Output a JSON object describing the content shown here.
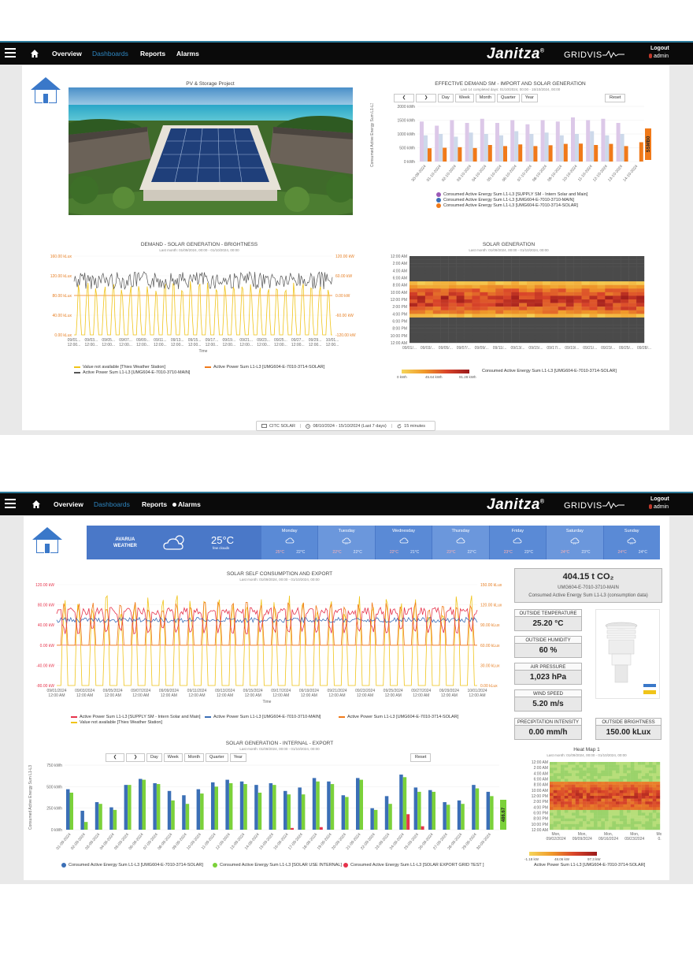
{
  "nav": {
    "overview": "Overview",
    "dashboards": "Dashboards",
    "reports": "Reports",
    "alarms": "Alarms",
    "brand": "Janitza",
    "product": "GRIDVIS",
    "logout": "Logout",
    "user": "admin"
  },
  "dash1": {
    "image_title": "PV & Storage Project",
    "demand_chart": {
      "title": "EFFECTIVE DEMAND SM - IMPORT AND SOLAR GENERATION",
      "subtitle": "Last 14 completed days: 01/10/2024, 00:00 - 15/10/2024, 00:00",
      "ylabel": "Consumed Active Energy Sum L1-L3",
      "yticks": [
        "2000 kWh",
        "1500 kWh",
        "1000 kWh",
        "500 kWh",
        "0 kWh"
      ],
      "buttons": [
        "Day",
        "Week",
        "Month",
        "Quarter",
        "Year"
      ],
      "reset": "Reset",
      "side_label": "SSMB0",
      "legend": [
        "Consumed Active Energy Sum L1-L3 [SUPPLY SM - Intern Solar and Main]",
        "Consumed Active Energy Sum L1-L3 [UMG604-E-7010-3710-MAIN]",
        "Consumed Active Energy Sum L1-L3 [UMG604-E-7010-3714-SOLAR]"
      ]
    },
    "brightness_chart": {
      "title": "DEMAND - SOLAR GENERATION - BRIGHTNESS",
      "subtitle": "Last month: 01/09/2024, 00:00 - 01/10/2024, 00:00",
      "yleft": [
        "160.00 kLux",
        "120.00 kLux",
        "80.00 kLux",
        "40.00 kLux",
        "0.00 kLux"
      ],
      "yright": [
        "120.00 kW",
        "60.00 kW",
        "0.00 kW",
        "-60.00 kW",
        "-120.00 kW"
      ],
      "xticks": [
        "09/01...",
        "09/03...",
        "09/05...",
        "09/07...",
        "09/09...",
        "09/11...",
        "09/13...",
        "09/15...",
        "09/17...",
        "09/19...",
        "09/21...",
        "09/23...",
        "09/25...",
        "09/27...",
        "09/29...",
        "10/01..."
      ],
      "xsub": "12:00...",
      "xlabel": "Time",
      "legend": [
        "Value not available [Thies Weather Station]",
        "Active Power Sum L1-L3 [UMG604-E-7010-3714-SOLAR]",
        "Active Power Sum L1-L3 [UMG604-E-7010-3710-MAIN]"
      ]
    },
    "heatmap_chart": {
      "title": "SOLAR GENERATION",
      "subtitle": "Last month: 01/09/2024, 00:00 - 01/10/2024, 00:00",
      "yticks": [
        "12:00 AM",
        "2:00 AM",
        "4:00 AM",
        "6:00 AM",
        "8:00 AM",
        "10:00 AM",
        "12:00 PM",
        "2:00 PM",
        "4:00 PM",
        "6:00 PM",
        "8:00 PM",
        "10:00 PM",
        "12:00 AM"
      ],
      "xticks": [
        "09/01/...",
        "09/03/...",
        "09/05/...",
        "09/07/...",
        "09/09/...",
        "09/11/...",
        "09/13/...",
        "09/15/...",
        "09/17/...",
        "09/19/...",
        "09/21/...",
        "09/23/...",
        "09/25/...",
        "09/28/..."
      ],
      "scale": [
        "0 kWh",
        "45.64 kWh",
        "91.28 kWh"
      ],
      "legend": "Consumed Active Energy Sum L1-L3 [UMG604-E-7010-3714-SOLAR]"
    },
    "footer": {
      "device": "CITC SOLAR",
      "range": "08/10/2024 - 15/10/2024 (Last 7 days)",
      "refresh": "15 minutes"
    }
  },
  "dash2": {
    "weather": {
      "location": "AVARUA",
      "label": "WEATHER",
      "temp": "25°C",
      "condition": "few clouds",
      "days": [
        {
          "name": "Monday",
          "hi": "25°C",
          "lo": "22°C"
        },
        {
          "name": "Tuesday",
          "hi": "22°C",
          "lo": "22°C"
        },
        {
          "name": "Wednesday",
          "hi": "22°C",
          "lo": "21°C"
        },
        {
          "name": "Thursday",
          "hi": "23°C",
          "lo": "22°C"
        },
        {
          "name": "Friday",
          "hi": "23°C",
          "lo": "23°C"
        },
        {
          "name": "Saturday",
          "hi": "24°C",
          "lo": "23°C"
        },
        {
          "name": "Sunday",
          "hi": "24°C",
          "lo": "24°C"
        }
      ]
    },
    "co2": {
      "value": "404.15 t CO₂",
      "meter": "UMG604-E-7010-3710-MAIN",
      "desc": "Consumed Active Energy Sum L1-L3 (consumption data)"
    },
    "kpis": {
      "temp": {
        "label": "OUTSIDE TEMPERATURE",
        "value": "25.20 °C"
      },
      "humidity": {
        "label": "OUTSIDE HUMIDITY",
        "value": "60 %"
      },
      "pressure": {
        "label": "AIR PRESSURE",
        "value": "1,023 hPa"
      },
      "wind": {
        "label": "WIND SPEED",
        "value": "5.20 m/s"
      },
      "precip": {
        "label": "PRECIPITATION INTENSITY",
        "value": "0.00 mm/h"
      },
      "brightness": {
        "label": "OUTSIDE BRIGHTNESS",
        "value": "150.00 kLux"
      }
    },
    "self_chart": {
      "title": "SOLAR SELF CONSUMPTION AND EXPORT",
      "subtitle": "Last month: 01/09/2024, 00:00 - 01/10/2024, 00:00",
      "yleft": [
        "120.00 kW",
        "80.00 kW",
        "40.00 kW",
        "0.00 kW",
        "-40.00 kW",
        "-80.00 kW"
      ],
      "yright": [
        "150.00 kLux",
        "120.00 kLux",
        "90.00 kLux",
        "60.00 kLux",
        "30.00 kLux",
        "0.00 kLux"
      ],
      "xticks": [
        "09/01/2024",
        "09/03/2024",
        "09/05/2024",
        "09/07/2024",
        "09/09/2024",
        "09/11/2024",
        "09/13/2024",
        "09/15/2024",
        "09/17/2024",
        "09/19/2024",
        "09/21/2024",
        "09/23/2024",
        "09/25/2024",
        "09/27/2024",
        "09/29/2024",
        "10/01/2024"
      ],
      "xsub": "12:00 AM",
      "xlabel": "Time",
      "legend": [
        "Active Power Sum L1-L3 [SUPPLY SM - Intern Solar and Main]",
        "Active Power Sum L1-L3 [UMG604-E-7010-3710-MAIN]",
        "Active Power Sum L1-L3 [UMG604-E-7010-3714-SOLAR]",
        "Value not available [Thies Weather Station]"
      ]
    },
    "export_chart": {
      "title": "SOLAR GENERATION - INTERNAL - EXPORT",
      "subtitle": "Last month: 01/09/2024, 00:00 - 01/10/2024, 00:00",
      "ylabel": "Consumed Active Energy Sum L1-L3",
      "yticks": [
        "750 kWh",
        "500 kWh",
        "250 kWh",
        "0 kWh"
      ],
      "buttons": [
        "Day",
        "Week",
        "Month",
        "Quarter",
        "Year"
      ],
      "reset": "Reset",
      "side_value": "486.67",
      "legend": [
        "Consumed Active Energy Sum L1-L3 [UMG604-E-7010-3714-SOLAR]",
        "Consumed Active Energy Sum L1-L3 [SOLAR USE INTERNAL]",
        "Consumed Active Energy Sum L1-L3 [SOLAR EXPORT GRID TEST ]"
      ]
    },
    "heatmap_small": {
      "title": "Heat Map 1",
      "subtitle": "Last month: 01/09/2024, 00:00 - 01/10/2024, 00:00",
      "yticks": [
        "12:00 AM",
        "2:00 AM",
        "4:00 AM",
        "6:00 AM",
        "8:00 AM",
        "10:00 AM",
        "12:00 PM",
        "2:00 PM",
        "4:00 PM",
        "6:00 PM",
        "8:00 PM",
        "10:00 PM",
        "12:00 AM"
      ],
      "xticks": [
        "Mon, 09/02/2024",
        "Mon, 09/09/2024",
        "Mon, 09/16/2024",
        "Mon, 09/23/2024",
        "Mon, 0..."
      ],
      "scale": [
        "-1.18 kW",
        "48.06 kW",
        "97.3 kW"
      ],
      "legend": "Active Power Sum L1-L3 [UMG604-E-7010-3714-SOLAR]"
    }
  },
  "colors": {
    "nav_bg": "#0a0a0a",
    "accent": "#2e86c1",
    "orange": "#f07a1a",
    "yellow": "#f0c419",
    "blue": "#3b6fb6",
    "green": "#7bd13a",
    "red": "#e6334b",
    "lilac": "#dcc8e8"
  }
}
